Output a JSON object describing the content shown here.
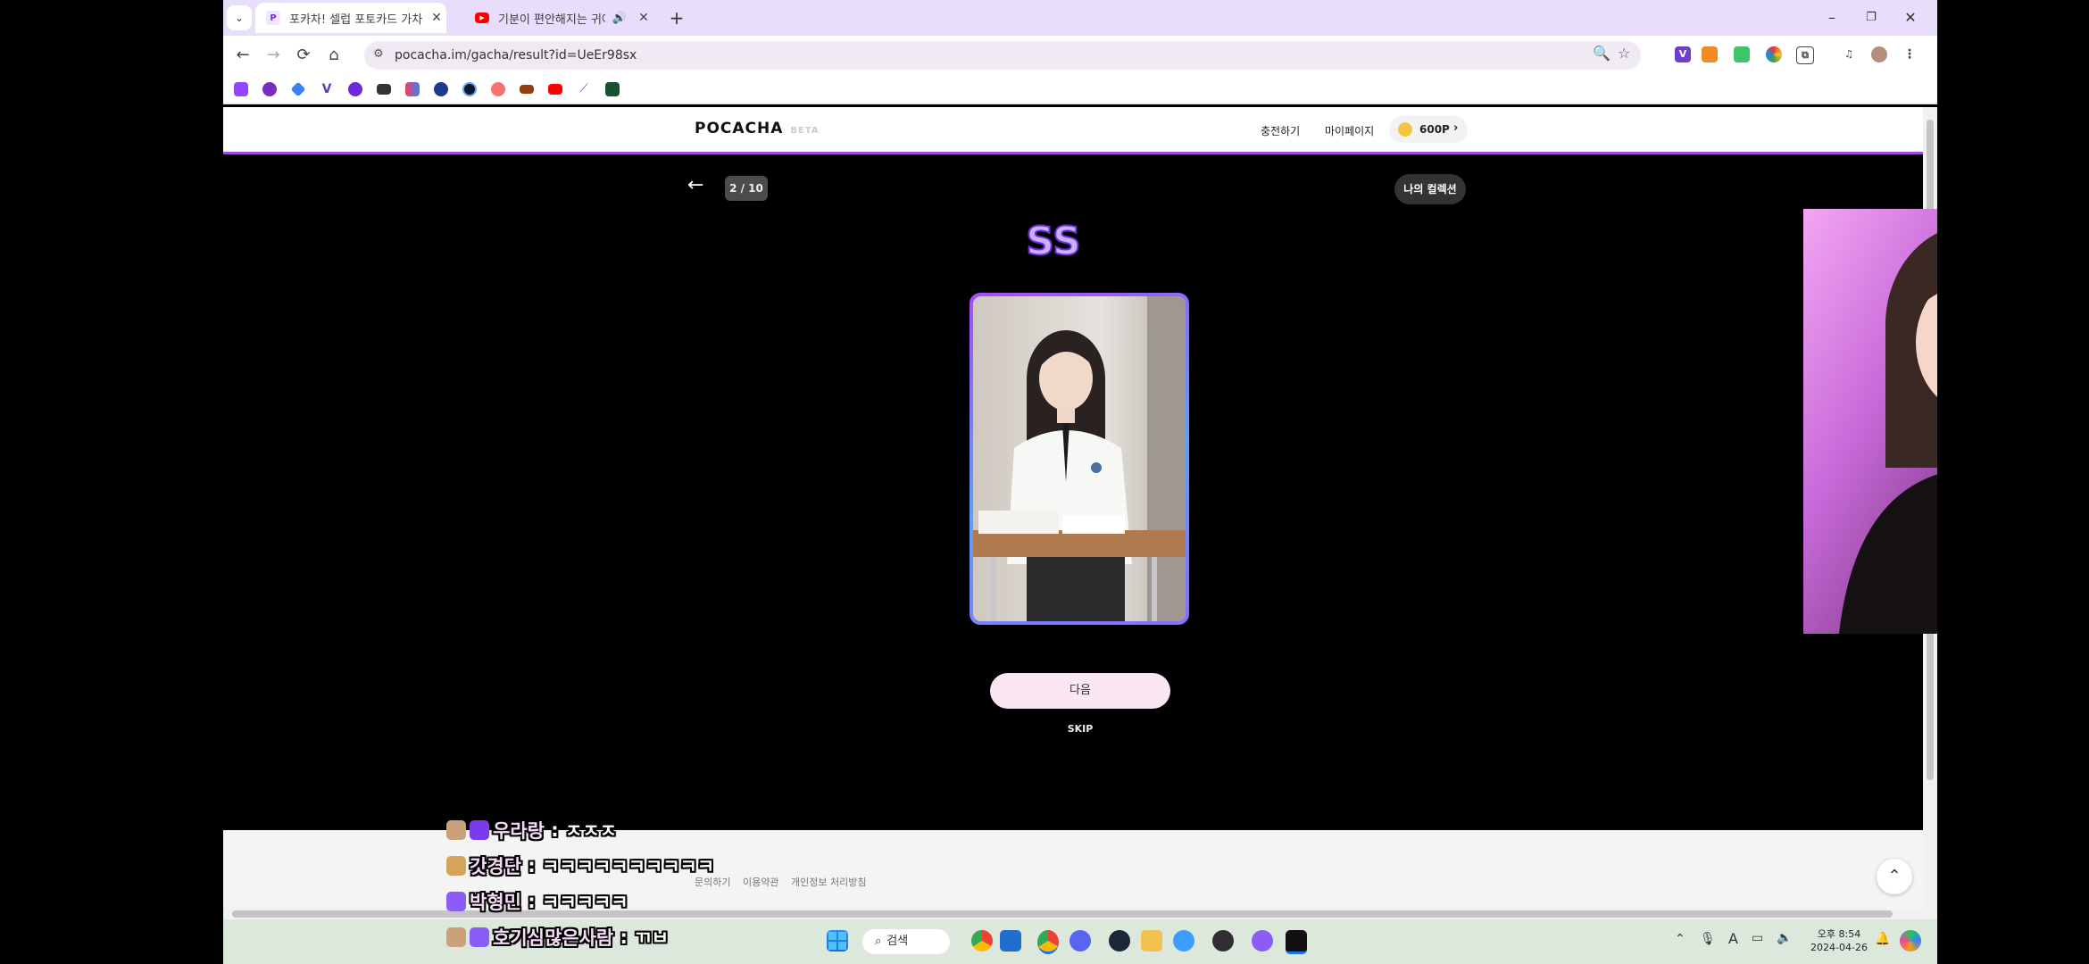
{
  "browser": {
    "tabs": [
      {
        "title": "포카차! 셀럽 포토카드 가차",
        "favicon": "P",
        "active": true
      },
      {
        "title": "기분이 편안해지는 귀여운",
        "favicon": "youtube-icon",
        "active": false
      }
    ],
    "new_tab": "+",
    "window_controls": {
      "minimize": "–",
      "restore": "❐",
      "close": "✕"
    },
    "url": "pocacha.im/gacha/result?id=UeEr98sx"
  },
  "site": {
    "logo": "POCACHA",
    "logo_badge": "BETA",
    "nav": {
      "charge": "충전하기",
      "mypage": "마이페이지"
    },
    "points": "600P",
    "progress": "2 / 10",
    "my_collection": "나의 컬렉션",
    "grade": "SS",
    "next_button": "다음",
    "skip": "SKIP",
    "footer": {
      "contact": "문의하기",
      "terms": "이용약관",
      "privacy": "개인정보 처리방침"
    }
  },
  "chat": [
    {
      "nick": "우라랑",
      "message": "ㅈㅈㅈ"
    },
    {
      "nick": "갓경단",
      "message": "ㅋㅋㅋㅋㅋㅋㅋㅋㅋㅋ"
    },
    {
      "nick": "박형민",
      "message": "ㅋㅋㅋㅋㅋ"
    },
    {
      "nick": "호기심많은사람",
      "message": "ㄲㅂ"
    }
  ],
  "taskbar": {
    "search": "검색",
    "time": "오후 8:54",
    "date": "2024-04-26"
  },
  "colors": {
    "tab_strip": "#e8defb",
    "accent_purple": "#a14bd8",
    "next_button_bg": "#fbe7f4",
    "taskbar_bg": "#dde8dc"
  }
}
